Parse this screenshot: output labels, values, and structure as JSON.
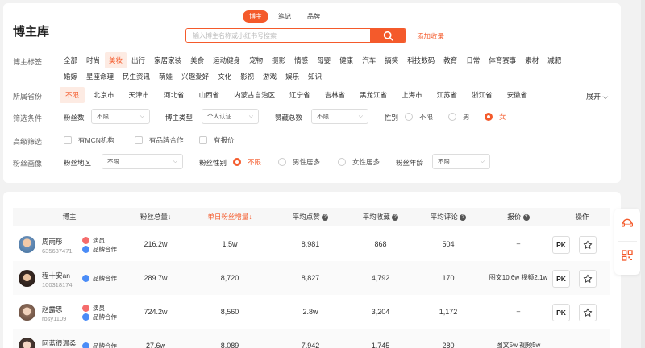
{
  "tabs": [
    "博主",
    "笔记",
    "品牌"
  ],
  "page_title": "博主库",
  "search": {
    "placeholder": "输入博主名称或小红书号搜索",
    "add_link": "添加收录"
  },
  "filters": {
    "tag_label": "博主标签",
    "tags": [
      "全部",
      "时尚",
      "美妆",
      "出行",
      "家居家装",
      "美食",
      "运动健身",
      "宠物",
      "摄影",
      "情感",
      "母婴",
      "健康",
      "汽车",
      "搞笑",
      "科技数码",
      "教育",
      "日常",
      "体育赛事",
      "素材",
      "减肥",
      "婚嫁",
      "星座命理",
      "民生资讯",
      "萌娃",
      "兴趣爱好",
      "文化",
      "影视",
      "游戏",
      "娱乐",
      "知识"
    ],
    "tag_selected": "美妆",
    "province_label": "所属省份",
    "provinces": [
      "不限",
      "北京市",
      "天津市",
      "河北省",
      "山西省",
      "内蒙古自治区",
      "辽宁省",
      "吉林省",
      "黑龙江省",
      "上海市",
      "江苏省",
      "浙江省",
      "安徽省"
    ],
    "province_selected": "不限",
    "expand_label": "展开",
    "cond_label": "筛选条件",
    "fans_count_label": "粉丝数",
    "fans_count_value": "不限",
    "blogger_type_label": "博主类型",
    "blogger_type_value": "个人认证",
    "likes_total_label": "赞藏总数",
    "likes_total_value": "不限",
    "gender_label": "性别",
    "gender_options": [
      "不限",
      "男",
      "女"
    ],
    "gender_selected": "女",
    "advanced_label": "高级筛选",
    "advanced_options": [
      "有MCN机构",
      "有品牌合作",
      "有报价"
    ],
    "portrait_label": "粉丝画像",
    "fans_region_label": "粉丝地区",
    "fans_region_value": "不限",
    "fans_gender_label": "粉丝性别",
    "fans_gender_options": [
      "不限",
      "男性居多",
      "女性居多"
    ],
    "fans_gender_selected": "不限",
    "fans_age_label": "粉丝年龄",
    "fans_age_value": "不限"
  },
  "table": {
    "headers": [
      "博主",
      "粉丝总量",
      "单日粉丝增量",
      "平均点赞",
      "平均收藏",
      "平均评论",
      "报价",
      "操作"
    ],
    "rows": [
      {
        "name": "周雨彤",
        "id": "635687471",
        "badges": [
          "演员",
          "品牌合作"
        ],
        "fans_total": "216.2w",
        "daily_gain": "1.5w",
        "avg_like": "8,981",
        "avg_fav": "868",
        "avg_comment": "504",
        "price": "–",
        "pk": "PK"
      },
      {
        "name": "程十安an",
        "id": "100318174",
        "badges": [
          "品牌合作"
        ],
        "fans_total": "289.7w",
        "daily_gain": "8,720",
        "avg_like": "8,827",
        "avg_fav": "4,792",
        "avg_comment": "170",
        "price": "图文10.6w 视频2.1w",
        "pk": "PK"
      },
      {
        "name": "赵露思",
        "id": "rosy1109",
        "badges": [
          "演员",
          "品牌合作"
        ],
        "fans_total": "724.2w",
        "daily_gain": "8,560",
        "avg_like": "2.8w",
        "avg_fav": "3,204",
        "avg_comment": "1,172",
        "price": "–",
        "pk": "PK"
      },
      {
        "name": "阿蓝很温柔",
        "id": "",
        "badges": [
          "品牌合作"
        ],
        "fans_total": "27.6w",
        "daily_gain": "8,089",
        "avg_like": "7,942",
        "avg_fav": "1,745",
        "avg_comment": "280",
        "price": "图文5w 视频5w",
        "pk": "PK"
      }
    ]
  },
  "colors": {
    "accent": "#f45a2b",
    "badge_red": "#f56c6c",
    "badge_blue": "#4a8cf7"
  }
}
